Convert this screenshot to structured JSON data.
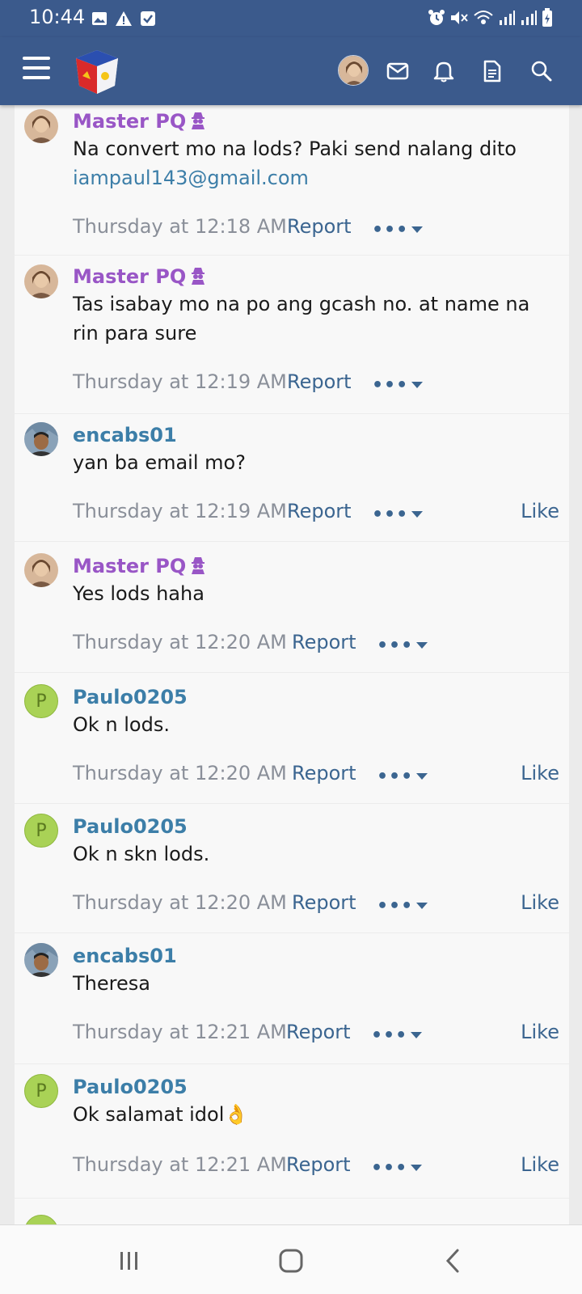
{
  "status_bar": {
    "time": "10:44",
    "icons": [
      "image-icon",
      "warning-icon",
      "checkbox-icon",
      "alarm-icon",
      "mute-icon",
      "wifi-icon",
      "signal-icon",
      "signal-icon",
      "battery-icon"
    ]
  },
  "header": {
    "menu_icon": "hamburger-menu-icon",
    "logo": "site-logo",
    "actions": [
      "avatar",
      "inbox-icon",
      "bell-icon",
      "document-icon",
      "search-icon"
    ]
  },
  "colors": {
    "header_bg": "#3b5a8c",
    "staff_name": "#9956c6",
    "member_name": "#3c7ea8",
    "link": "#3b6590",
    "avatar_green": "#a9d256"
  },
  "messages": [
    {
      "user": "Master PQ",
      "staff": true,
      "avatar": "photo-woman",
      "text": "Na convert mo na lods? Paki send nalang dito",
      "link": "iampaul143@gmail.com",
      "time": "Thursday at 12:18 AM",
      "report": "Report",
      "like": ""
    },
    {
      "user": "Master PQ",
      "staff": true,
      "avatar": "photo-woman",
      "text": "Tas isabay mo na po ang gcash no. at name na rin para sure",
      "link": "",
      "time": "Thursday at 12:19 AM",
      "report": "Report",
      "like": ""
    },
    {
      "user": "encabs01",
      "staff": false,
      "avatar": "photo-man",
      "text": "yan ba email mo?",
      "link": "",
      "time": "Thursday at 12:19 AM",
      "report": "Report",
      "like": "Like"
    },
    {
      "user": "Master PQ",
      "staff": true,
      "avatar": "photo-woman",
      "text": "Yes lods haha",
      "link": "",
      "time": "Thursday at 12:20 AM",
      "report": "Report",
      "like": ""
    },
    {
      "user": "Paulo0205",
      "staff": false,
      "avatar": "P",
      "text": "Ok n lods.",
      "link": "",
      "time": "Thursday at 12:20 AM",
      "report": "Report",
      "like": "Like"
    },
    {
      "user": "Paulo0205",
      "staff": false,
      "avatar": "P",
      "text": "Ok n skn lods.",
      "link": "",
      "time": "Thursday at 12:20 AM",
      "report": "Report",
      "like": "Like"
    },
    {
      "user": "encabs01",
      "staff": false,
      "avatar": "photo-man",
      "text": "Theresa",
      "link": "",
      "time": "Thursday at 12:21 AM",
      "report": "Report",
      "like": "Like"
    },
    {
      "user": "Paulo0205",
      "staff": false,
      "avatar": "P",
      "text": "Ok salamat idol",
      "emoji": "👌",
      "link": "",
      "time": "Thursday at 12:21 AM",
      "report": "Report",
      "like": "Like"
    }
  ],
  "nav_bar": [
    "recent-apps-icon",
    "home-icon",
    "back-icon"
  ]
}
